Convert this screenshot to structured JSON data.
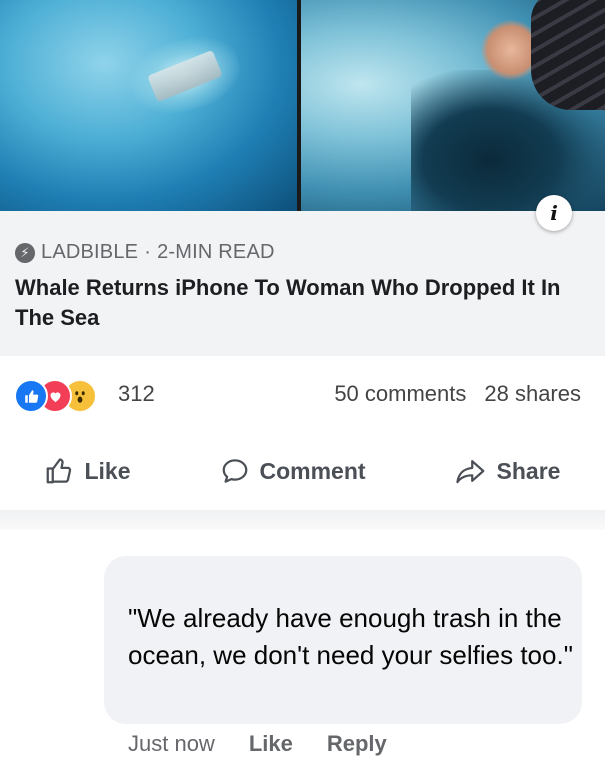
{
  "preview": {
    "source": "LADBIBLE",
    "separator": "·",
    "read_time": "2-MIN READ",
    "headline": "Whale Returns iPhone To Woman Who Dropped It In The Sea",
    "info_icon": "info-icon"
  },
  "reactions": {
    "icons": [
      "like-reaction-icon",
      "love-reaction-icon",
      "wow-reaction-icon"
    ],
    "count": "312",
    "comments": "50 comments",
    "shares": "28 shares"
  },
  "actions": {
    "like": "Like",
    "comment": "Comment",
    "share": "Share"
  },
  "comment": {
    "text": "\"We already have enough trash in the ocean, we don't need your selfies too.\"",
    "timestamp": "Just now",
    "like": "Like",
    "reply": "Reply"
  },
  "colors": {
    "brand_blue": "#1877f2",
    "love_red": "#f33e58",
    "wow_yellow": "#f7c03a",
    "muted_text": "#65676b",
    "preview_bg": "#f2f3f5"
  }
}
